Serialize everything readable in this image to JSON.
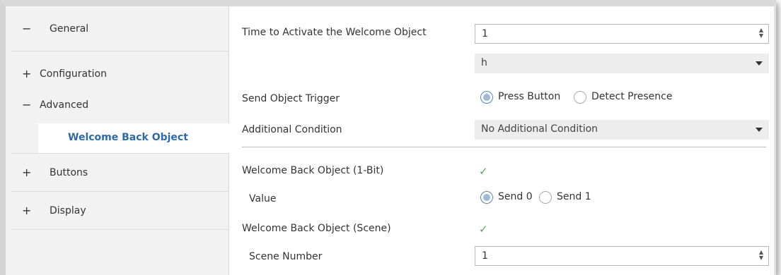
{
  "sidebar": {
    "items": [
      {
        "symbol": "−",
        "label": "General"
      },
      {
        "symbol": "+",
        "label": "Configuration"
      },
      {
        "symbol": "−",
        "label": "Advanced"
      },
      {
        "symbol": "",
        "label": "Welcome Back Object"
      },
      {
        "symbol": "+",
        "label": "Buttons"
      },
      {
        "symbol": "+",
        "label": "Display"
      }
    ]
  },
  "main": {
    "time_label": "Time to Activate the Welcome Object",
    "time_value": "1",
    "unit_value": "h",
    "trigger_label": "Send Object Trigger",
    "trigger_options": [
      "Press Button",
      "Detect Presence"
    ],
    "trigger_selected": "Press Button",
    "condition_label": "Additional Condition",
    "condition_value": "No Additional Condition",
    "onebit_label": "Welcome Back Object (1-Bit)",
    "onebit_checked": true,
    "value_label": "Value",
    "value_options": [
      "Send 0",
      "Send 1"
    ],
    "value_selected": "Send 0",
    "scene_obj_label": "Welcome Back Object (Scene)",
    "scene_obj_checked": true,
    "scene_number_label": "Scene Number",
    "scene_number_value": "1",
    "check_glyph": "✓"
  },
  "colors": {
    "sidebar_bg": "#f2f2f2",
    "active_text": "#2e6aa7",
    "check": "#5aa35a",
    "select_bg": "#ededed"
  }
}
